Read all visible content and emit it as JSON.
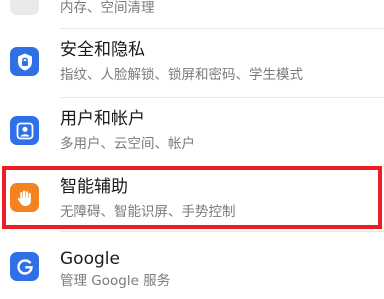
{
  "settings": {
    "items": [
      {
        "title": "",
        "subtitle": "内存、空间清理",
        "icon": "storage-icon"
      },
      {
        "title": "安全和隐私",
        "subtitle": "指纹、人脸解锁、锁屏和密码、学生模式",
        "icon": "shield-icon"
      },
      {
        "title": "用户和帐户",
        "subtitle": "多用户、云空间、帐户",
        "icon": "user-icon"
      },
      {
        "title": "智能辅助",
        "subtitle": "无障碍、智能识屏、手势控制",
        "icon": "hand-icon"
      },
      {
        "title": "Google",
        "subtitle": "管理 Google 服务",
        "icon": "google-icon"
      }
    ]
  },
  "colors": {
    "blue_icon": "#2f6fe8",
    "orange_icon": "#f5821f",
    "highlight_border": "#ee1c25"
  }
}
